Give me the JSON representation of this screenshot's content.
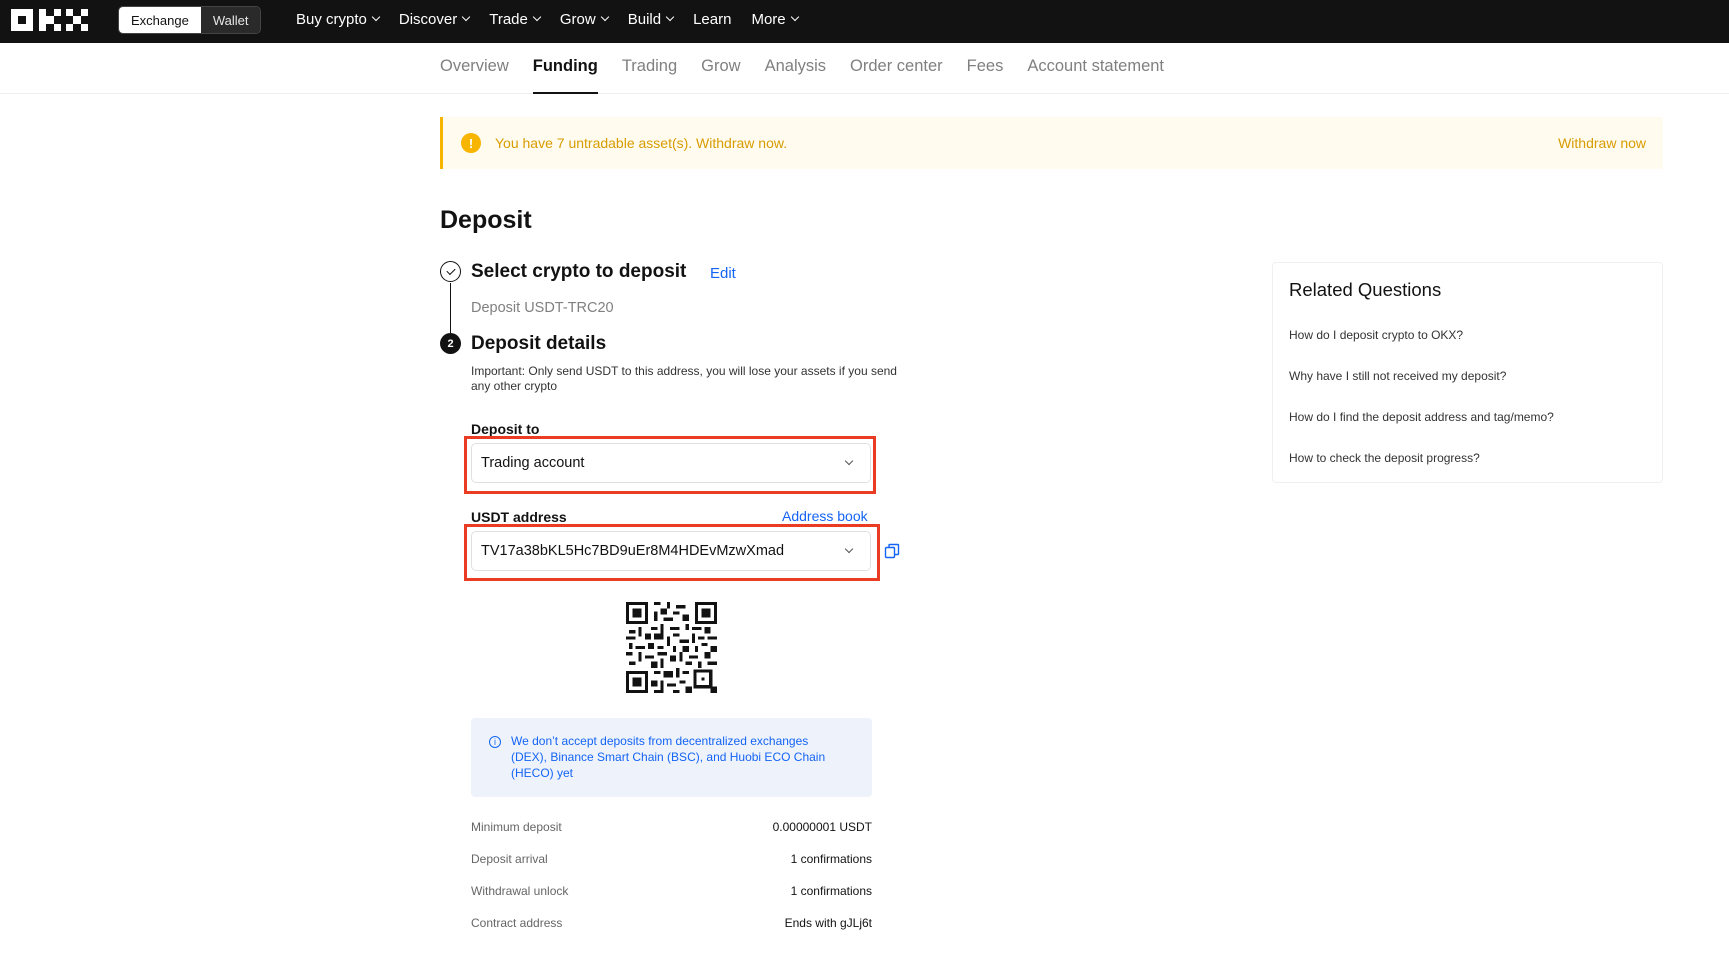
{
  "colors": {
    "accent": "#1464f5",
    "warning": "#f7b500",
    "highlight": "#ea3b23",
    "topbar": "#121212"
  },
  "topbar": {
    "logo": "OKX",
    "mode_tabs": [
      "Exchange",
      "Wallet"
    ],
    "nav": [
      "Buy crypto",
      "Discover",
      "Trade",
      "Grow",
      "Build",
      "Learn",
      "More"
    ]
  },
  "subnav": {
    "tabs": [
      "Overview",
      "Funding",
      "Trading",
      "Grow",
      "Analysis",
      "Order center",
      "Fees",
      "Account statement"
    ],
    "active": "Funding"
  },
  "banner": {
    "message": "You have 7 untradable asset(s). Withdraw now.",
    "action": "Withdraw now"
  },
  "page": {
    "title": "Deposit"
  },
  "step1": {
    "number": "1",
    "title": "Select crypto to deposit",
    "edit": "Edit",
    "summary": "Deposit USDT-TRC20"
  },
  "step2": {
    "number": "2",
    "title": "Deposit details",
    "important": "Important: Only send USDT to this address, you will lose your assets if you send any other crypto",
    "deposit_to_label": "Deposit to",
    "deposit_to_value": "Trading account",
    "address_label": "USDT address",
    "address_book": "Address book",
    "address_value": "TV17a38bKL5Hc7BD9uEr8M4HDEvMzwXmad",
    "notice": "We don’t accept deposits from decentralized exchanges (DEX), Binance Smart Chain (BSC), and Huobi ECO Chain (HECO) yet"
  },
  "details": [
    {
      "key": "Minimum deposit",
      "value": "0.00000001 USDT"
    },
    {
      "key": "Deposit arrival",
      "value": "1 confirmations"
    },
    {
      "key": "Withdrawal unlock",
      "value": "1 confirmations"
    },
    {
      "key": "Contract address",
      "value": "Ends with gJLj6t"
    }
  ],
  "related": {
    "title": "Related Questions",
    "questions": [
      "How do I deposit crypto to OKX?",
      "Why have I still not received my deposit?",
      "How do I find the deposit address and tag/memo?",
      "How to check the deposit progress?"
    ]
  }
}
